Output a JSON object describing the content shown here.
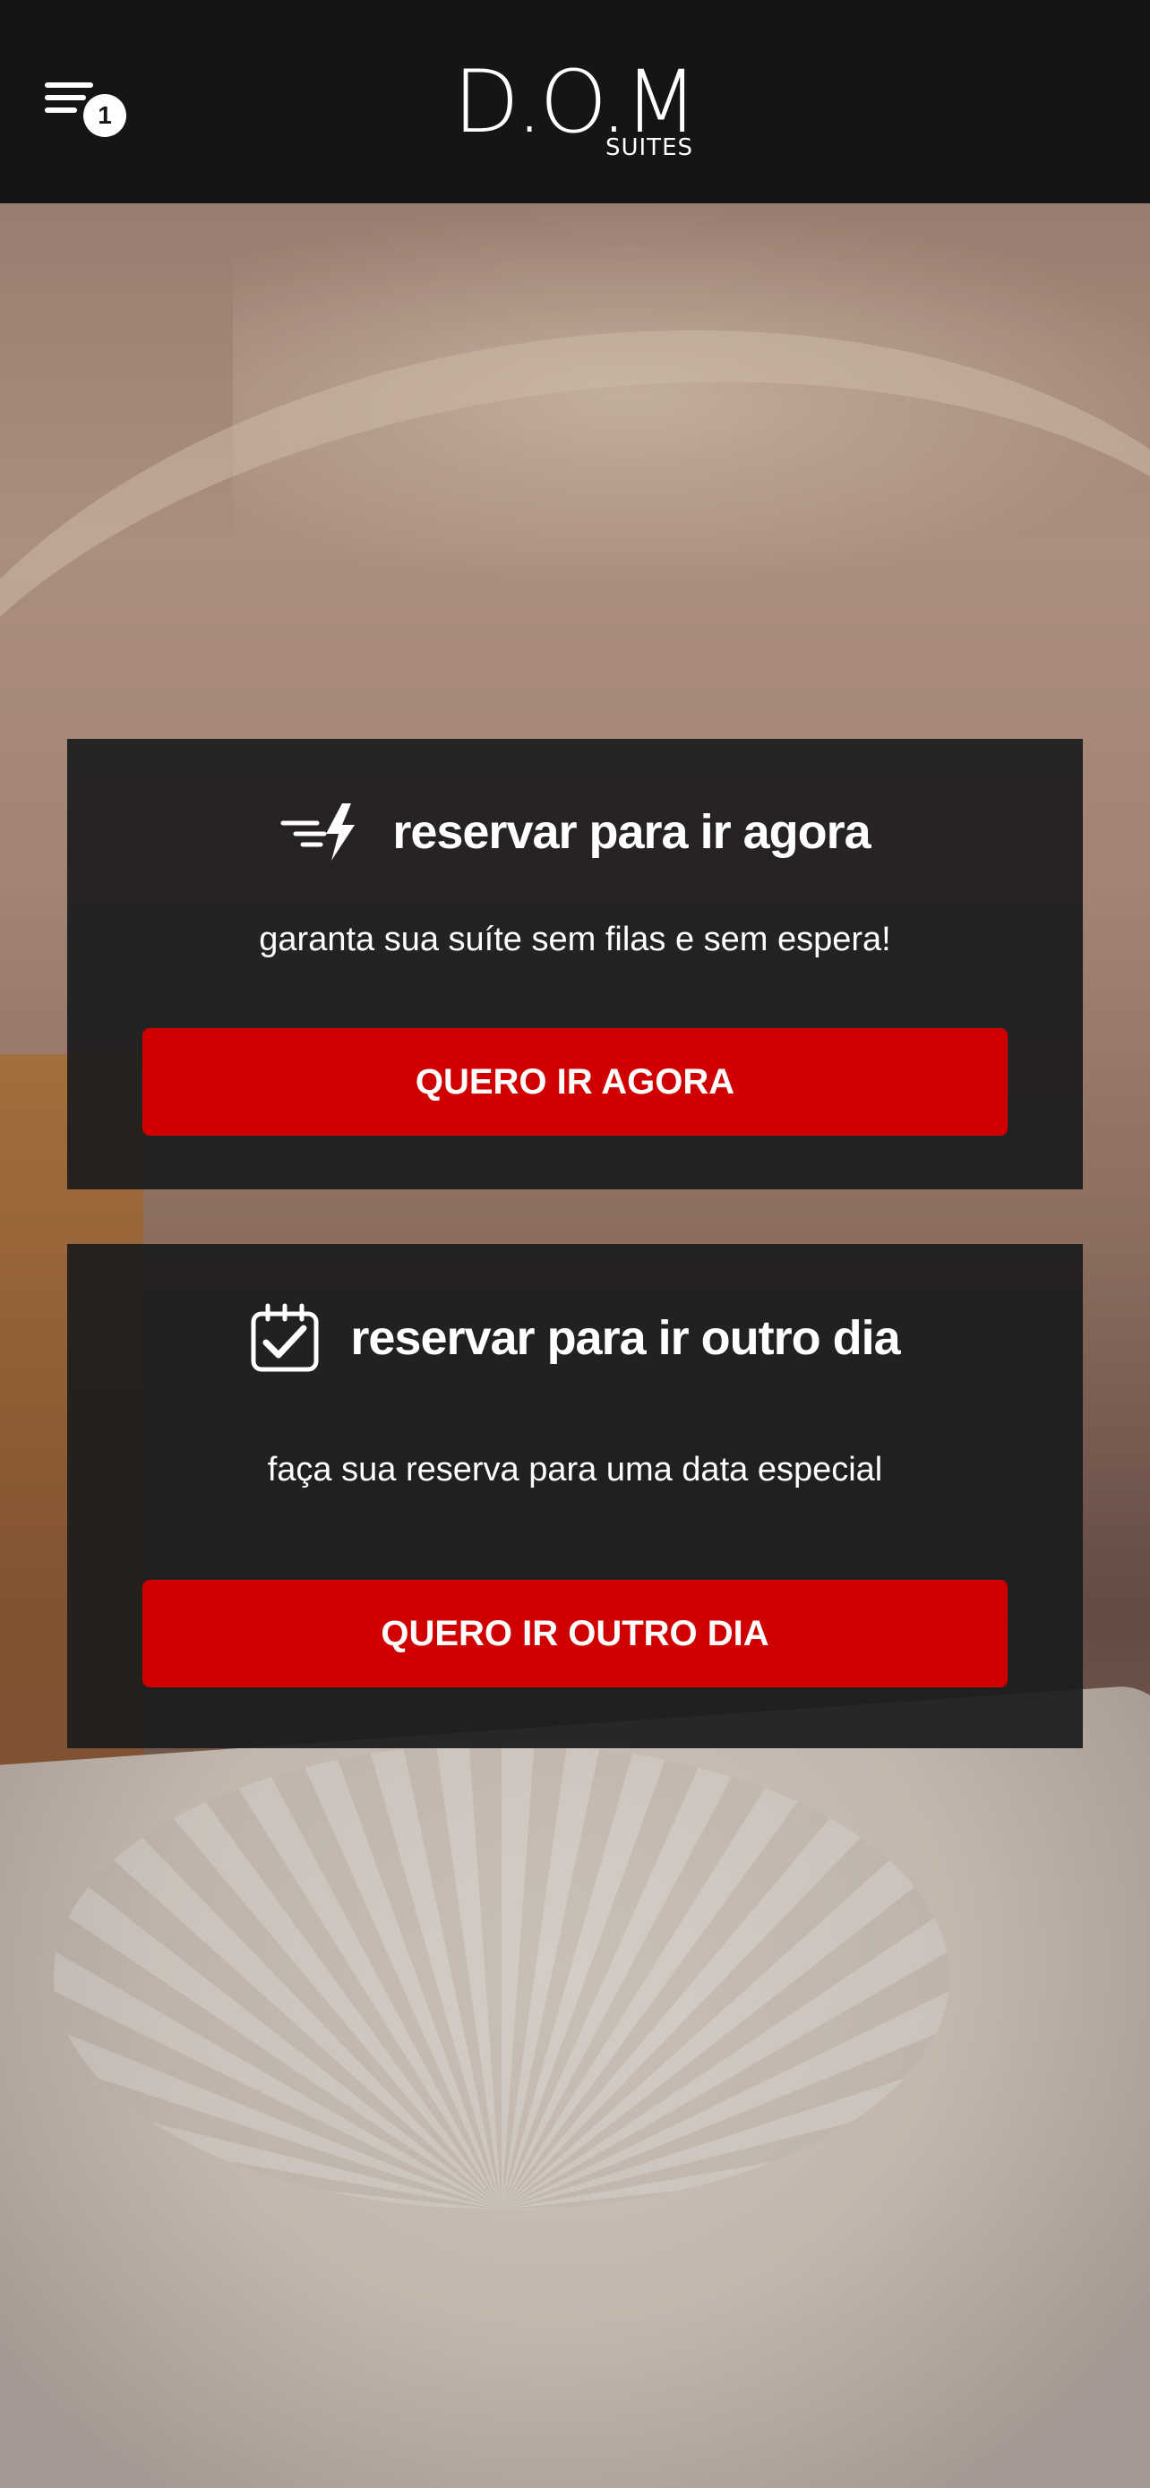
{
  "header": {
    "menu_badge_count": "1",
    "logo_main": "D.O.M",
    "logo_sub": "SUITES"
  },
  "cards": [
    {
      "icon": "fast-lightning-icon",
      "title": "reservar para ir agora",
      "subtitle": "garanta sua suíte sem filas e sem espera!",
      "button_label": "QUERO IR AGORA"
    },
    {
      "icon": "calendar-check-icon",
      "title": "reservar para ir outro dia",
      "subtitle": "faça sua reserva para uma data especial",
      "button_label": "QUERO IR OUTRO DIA"
    }
  ],
  "colors": {
    "header_bg": "#151515",
    "card_bg": "#1c1c1c",
    "accent_red": "#d10000",
    "text": "#ffffff"
  }
}
